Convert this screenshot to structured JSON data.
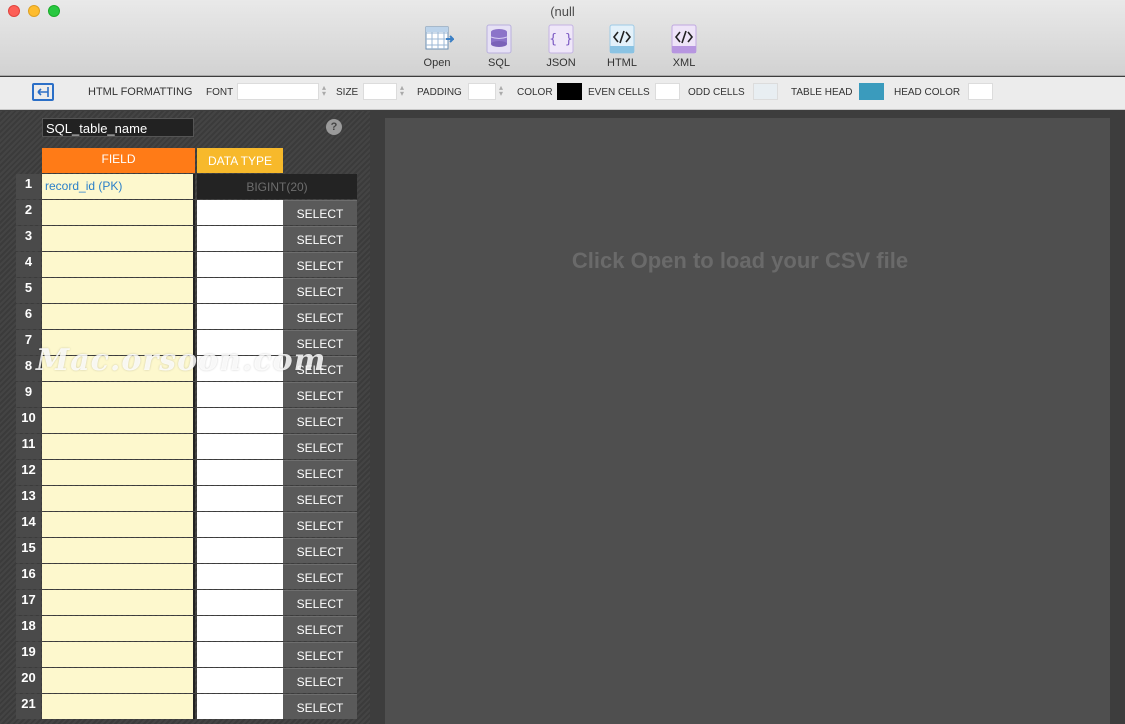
{
  "window": {
    "title": "(null"
  },
  "toolbar": [
    {
      "label": "Open",
      "icon": "table-open-icon"
    },
    {
      "label": "SQL",
      "icon": "database-icon"
    },
    {
      "label": "JSON",
      "icon": "json-braces-icon"
    },
    {
      "label": "HTML",
      "icon": "html-code-icon"
    },
    {
      "label": "XML",
      "icon": "xml-code-icon"
    }
  ],
  "formatting": {
    "title": "HTML FORMATTING",
    "font_label": "FONT",
    "font_value": "",
    "size_label": "SIZE",
    "size_value": "",
    "padding_label": "PADDING",
    "padding_value": "",
    "color_label": "COLOR",
    "color_value": "#000000",
    "even_cells_label": "EVEN CELLS",
    "even_cells_color": "#ffffff",
    "odd_cells_label": "ODD CELLS",
    "odd_cells_color": "#e8eef2",
    "table_head_label": "TABLE HEAD",
    "table_head_color": "#3a9bbd",
    "head_color_label": "HEAD COLOR",
    "head_color_value": "#ffffff"
  },
  "table": {
    "name": "SQL_table_name",
    "help": "?",
    "field_header": "FIELD",
    "type_header": "DATA TYPE",
    "select_label": "SELECT",
    "rows": [
      {
        "num": "1",
        "field": "record_id (PK)",
        "type": "BIGINT(20)"
      },
      {
        "num": "2",
        "field": "",
        "type": ""
      },
      {
        "num": "3",
        "field": "",
        "type": ""
      },
      {
        "num": "4",
        "field": "",
        "type": ""
      },
      {
        "num": "5",
        "field": "",
        "type": ""
      },
      {
        "num": "6",
        "field": "",
        "type": ""
      },
      {
        "num": "7",
        "field": "",
        "type": ""
      },
      {
        "num": "8",
        "field": "",
        "type": ""
      },
      {
        "num": "9",
        "field": "",
        "type": ""
      },
      {
        "num": "10",
        "field": "",
        "type": ""
      },
      {
        "num": "11",
        "field": "",
        "type": ""
      },
      {
        "num": "12",
        "field": "",
        "type": ""
      },
      {
        "num": "13",
        "field": "",
        "type": ""
      },
      {
        "num": "14",
        "field": "",
        "type": ""
      },
      {
        "num": "15",
        "field": "",
        "type": ""
      },
      {
        "num": "16",
        "field": "",
        "type": ""
      },
      {
        "num": "17",
        "field": "",
        "type": ""
      },
      {
        "num": "18",
        "field": "",
        "type": ""
      },
      {
        "num": "19",
        "field": "",
        "type": ""
      },
      {
        "num": "20",
        "field": "",
        "type": ""
      },
      {
        "num": "21",
        "field": "",
        "type": ""
      }
    ]
  },
  "preview": {
    "message": "Click Open to load your CSV file"
  },
  "watermark": "Mac.orsoon.com"
}
